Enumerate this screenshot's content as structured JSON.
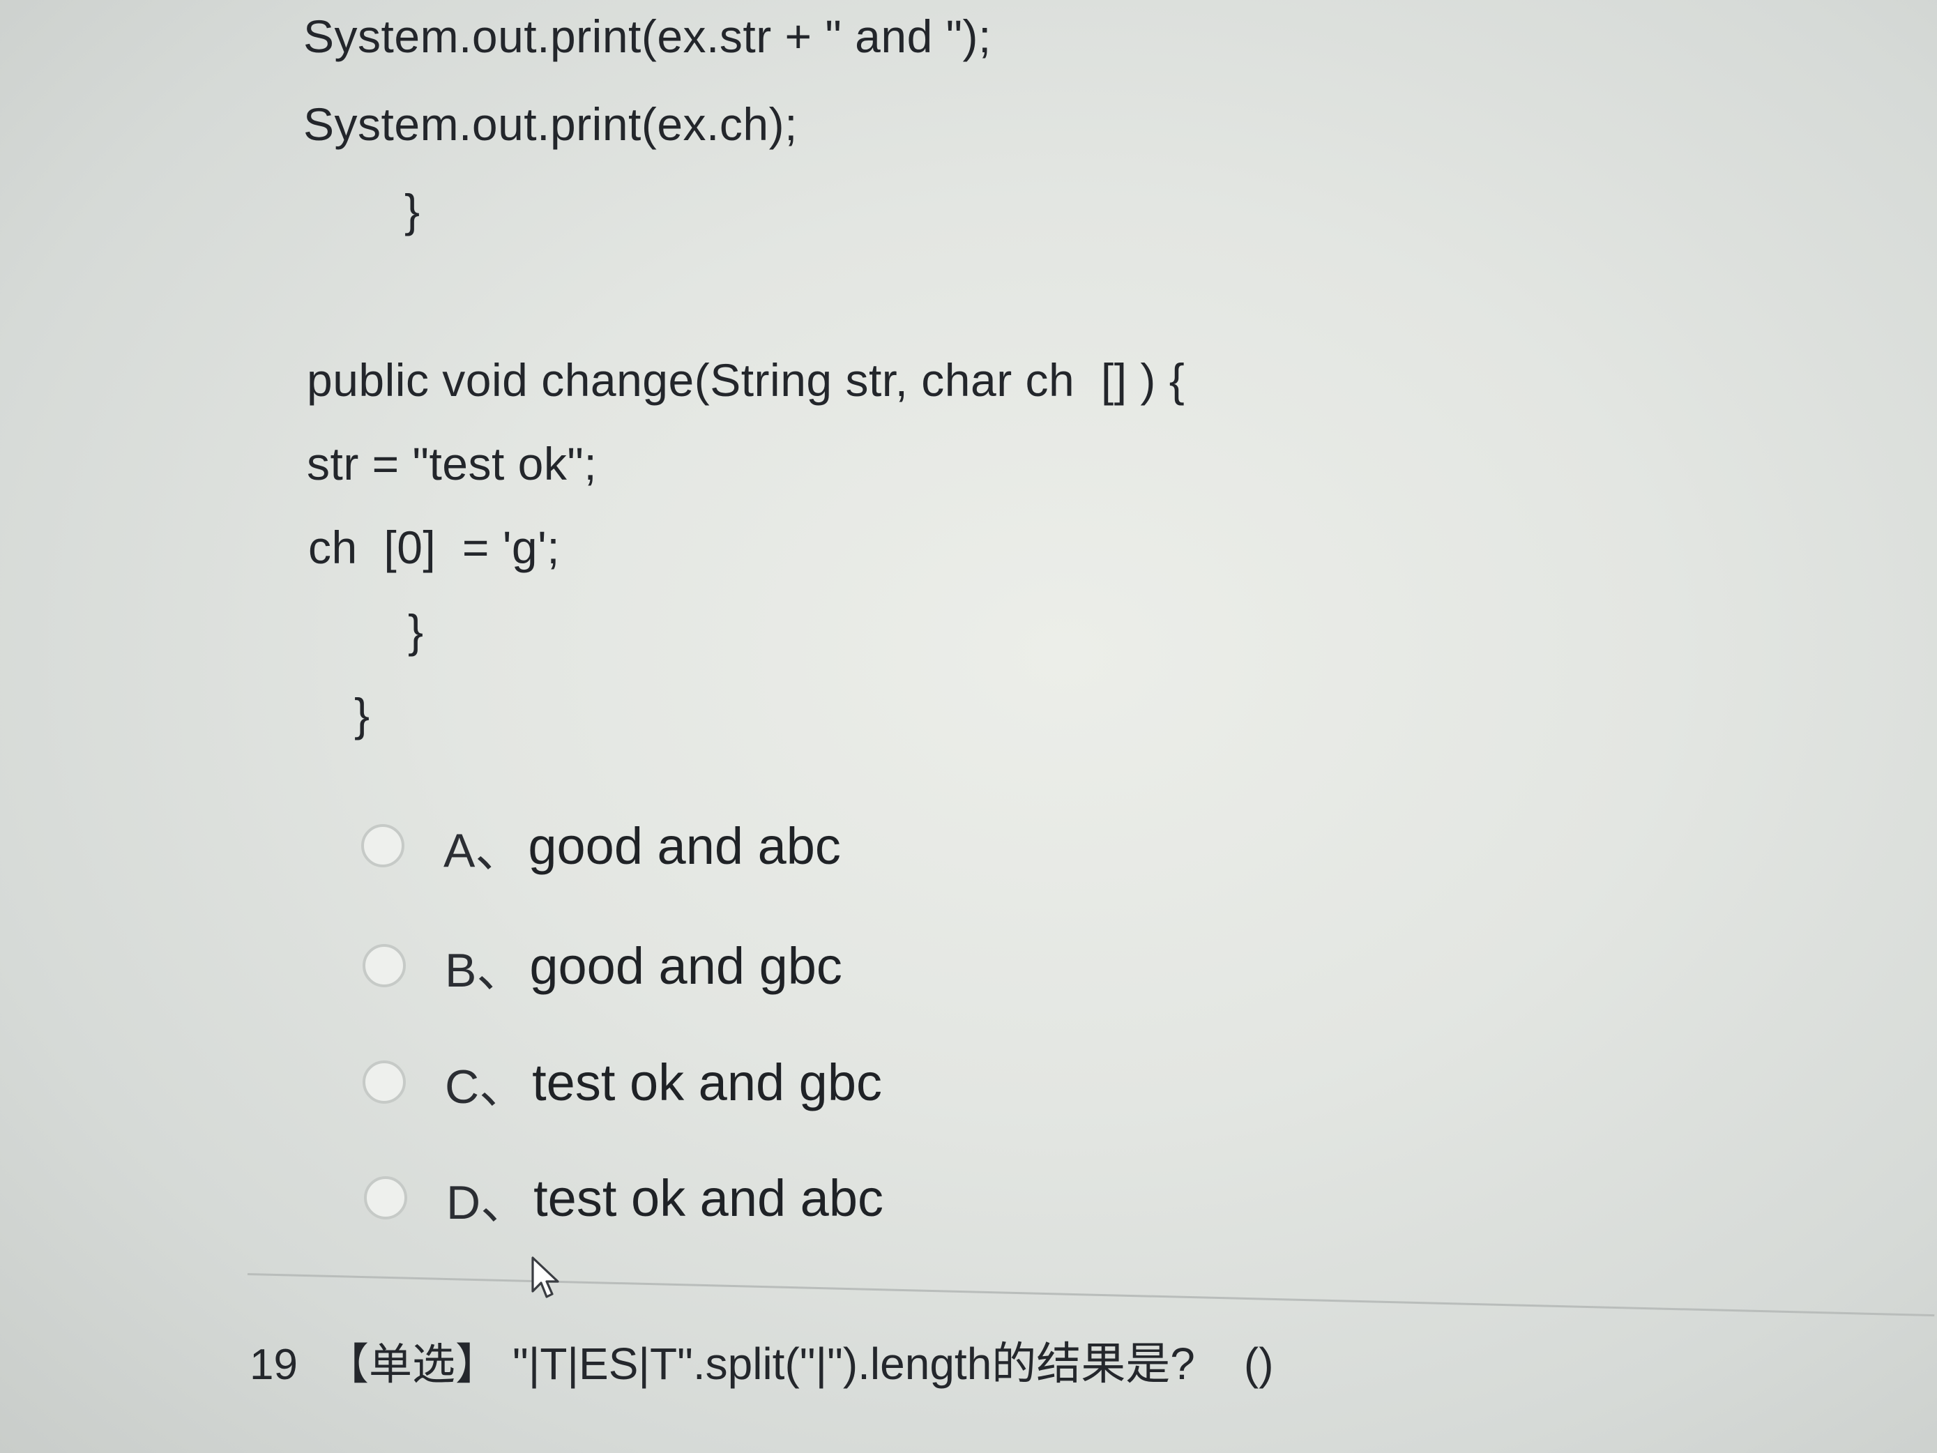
{
  "code_lines": [
    "System.out.print(ex.str + \" and \");",
    "System.out.print(ex.ch);",
    "}",
    "public void change(String str, char ch  [] ) {",
    "str = \"test ok\";",
    "ch  [0]  = 'g';",
    "}",
    "}"
  ],
  "options": [
    {
      "letter": "A、",
      "text": "good and abc"
    },
    {
      "letter": "B、",
      "text": "good and gbc"
    },
    {
      "letter": "C、",
      "text": "test ok and gbc"
    },
    {
      "letter": "D、",
      "text": "test ok and abc"
    }
  ],
  "next_question": {
    "number": "19",
    "type": "【单选】",
    "text": "\"|T|ES|T\".split(\"|\").length的结果是?",
    "answer_blank": "()"
  },
  "icons": {
    "radio": "radio-button-icon",
    "cursor": "mouse-pointer-icon"
  },
  "colors": {
    "text": "#1f2226",
    "radio_border": "#c6cac7",
    "divider": "#b9bdbb"
  }
}
